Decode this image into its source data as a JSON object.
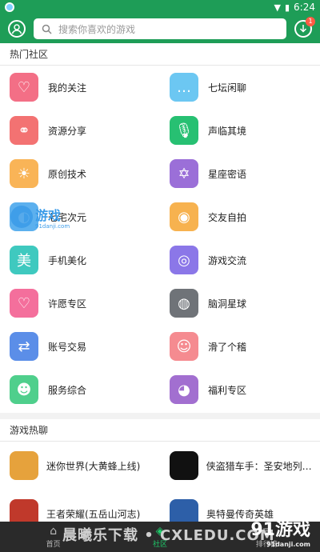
{
  "status_bar": {
    "time": "6:24"
  },
  "search": {
    "placeholder": "搜索你喜欢的游戏"
  },
  "download_badge": "1",
  "hot_communities": {
    "title": "热门社区",
    "items": [
      {
        "label": "我的关注",
        "icon": "heart-plus-icon",
        "color": "#f36f86"
      },
      {
        "label": "七坛闲聊",
        "icon": "chat-bubble-icon",
        "color": "#6cc7f2"
      },
      {
        "label": "资源分享",
        "icon": "link-icon",
        "color": "#f37272"
      },
      {
        "label": "声临其境",
        "icon": "microphone-icon",
        "color": "#27c072"
      },
      {
        "label": "原创技术",
        "icon": "bulb-icon",
        "color": "#f9b457"
      },
      {
        "label": "星座密语",
        "icon": "star-of-david-icon",
        "color": "#9b6fd8"
      },
      {
        "label": "七宅次元",
        "icon": "anime-icon",
        "color": "#5cb0ee"
      },
      {
        "label": "交友自拍",
        "icon": "camera-icon",
        "color": "#f7b24f"
      },
      {
        "label": "手机美化",
        "icon": "beauty-icon",
        "color": "#3fc9bf"
      },
      {
        "label": "游戏交流",
        "icon": "gamepad-icon",
        "color": "#8b77e8"
      },
      {
        "label": "许愿专区",
        "icon": "heart-outline-icon",
        "color": "#f46f9c"
      },
      {
        "label": "脑洞星球",
        "icon": "ufo-icon",
        "color": "#6f7378"
      },
      {
        "label": "账号交易",
        "icon": "exchange-icon",
        "color": "#5b8ee8"
      },
      {
        "label": "滑了个稽",
        "icon": "funny-face-icon",
        "color": "#f58b90"
      },
      {
        "label": "服务综合",
        "icon": "service-icon",
        "color": "#4fcf8c"
      },
      {
        "label": "福利专区",
        "icon": "piggy-bank-icon",
        "color": "#a26fd0"
      }
    ]
  },
  "hot_games": {
    "title": "游戏热聊",
    "items": [
      {
        "name": "迷你世界(大黄蜂上线)",
        "color": "#e6a23c"
      },
      {
        "name": "侠盗猎车手：圣安地列斯汉",
        "color": "#111111"
      },
      {
        "name": "王者荣耀(五岳山河志)",
        "color": "#c0392b"
      },
      {
        "name": "奥特曼传奇英雄",
        "color": "#2d5fa8"
      }
    ]
  },
  "tabs": [
    {
      "label": "首页",
      "icon": "home-icon"
    },
    {
      "label": "社区",
      "icon": "community-icon"
    },
    {
      "label": "排行榜",
      "icon": "rank-icon"
    }
  ],
  "watermarks": {
    "left": "游戏",
    "left_sub": "91danji.com",
    "bottom": "晨曦乐下载 • CXLEDU.COM",
    "right": "91游戏",
    "right_sub": "91danji.com"
  }
}
